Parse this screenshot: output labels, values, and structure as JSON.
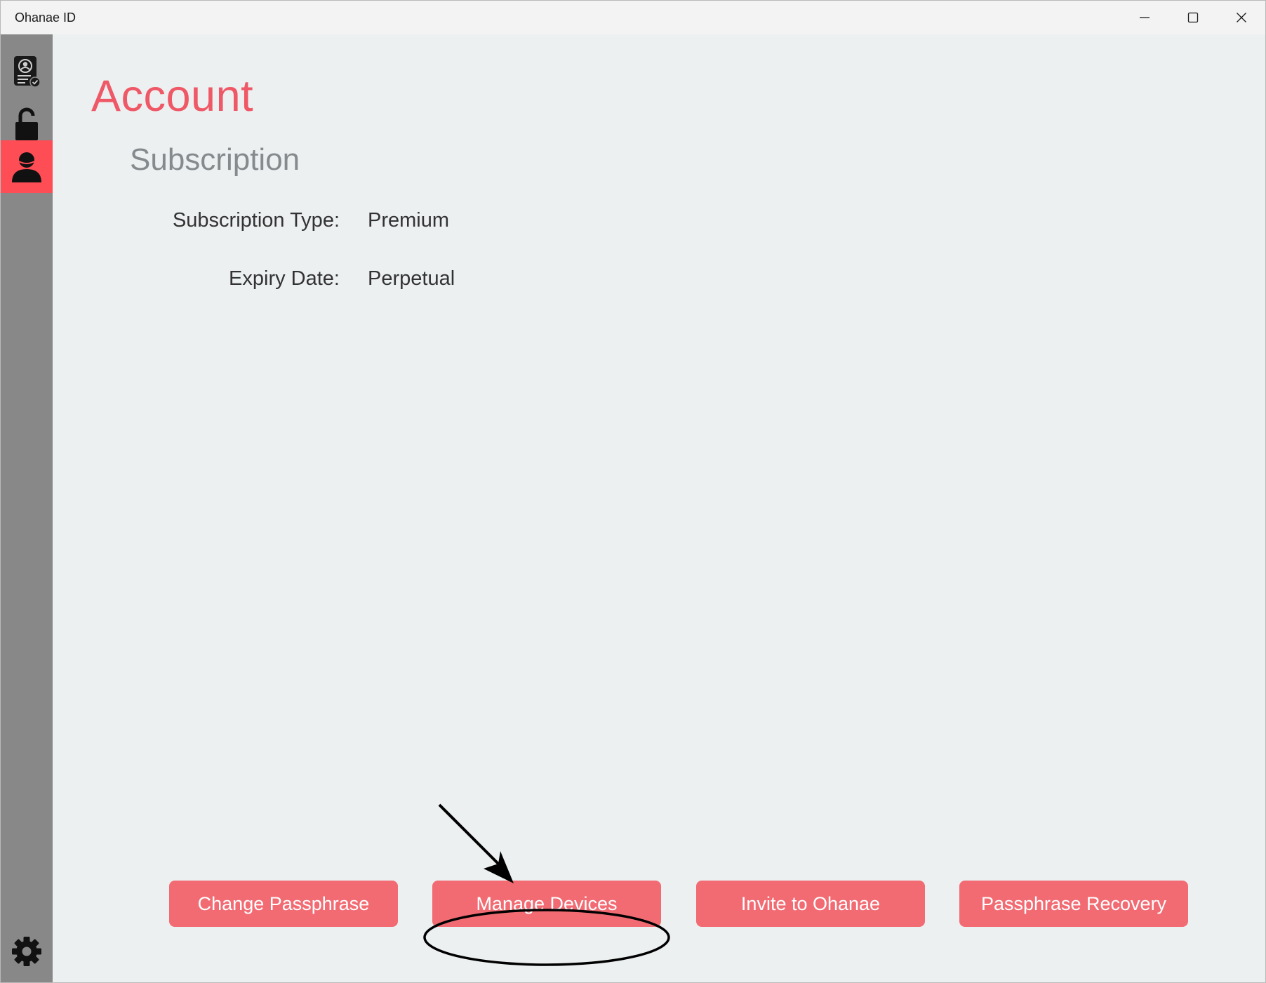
{
  "window": {
    "title": "Ohanae ID",
    "controls": [
      "minimize-icon",
      "maximize-icon",
      "close-icon"
    ]
  },
  "sidebar": {
    "items": [
      {
        "name": "id-card-icon",
        "active": false
      },
      {
        "name": "unlock-icon",
        "active": false
      },
      {
        "name": "user-icon",
        "active": true
      }
    ],
    "settings_icon": "gear-icon"
  },
  "colors": {
    "accent": "#ef5866",
    "button": "#f26b73",
    "active_nav": "#ff4d55",
    "sidebar": "#888888",
    "background": "#ecf0f1"
  },
  "page": {
    "title": "Account",
    "section_title": "Subscription",
    "fields": [
      {
        "label": "Subscription Type:",
        "value": "Premium"
      },
      {
        "label": "Expiry Date:",
        "value": "Perpetual"
      }
    ]
  },
  "actions": {
    "change_passphrase": "Change Passphrase",
    "manage_devices": "Manage Devices",
    "invite": "Invite to Ohanae",
    "passphrase_recovery": "Passphrase Recovery"
  }
}
